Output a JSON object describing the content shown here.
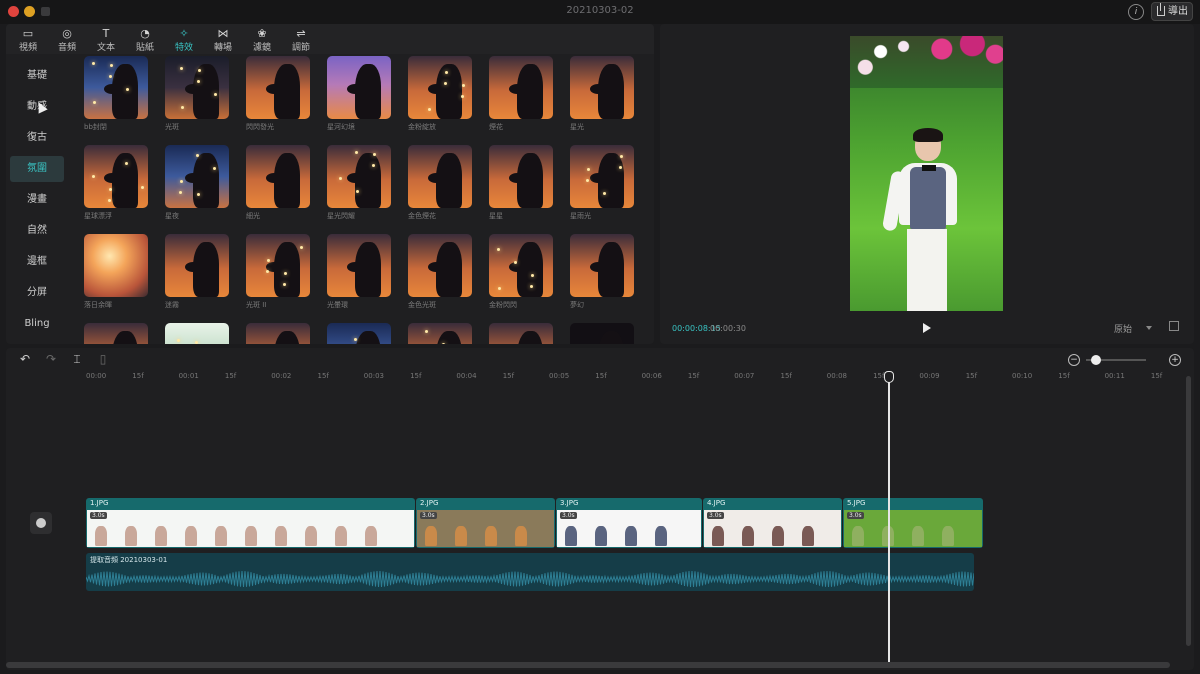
{
  "window": {
    "title": "20210303-02",
    "export_label": "導出"
  },
  "tabs": [
    {
      "label": "視頻",
      "icon": "video-icon",
      "glyph": "▭"
    },
    {
      "label": "音頻",
      "icon": "audio-icon",
      "glyph": "◎"
    },
    {
      "label": "文本",
      "icon": "text-icon",
      "glyph": "T"
    },
    {
      "label": "貼紙",
      "icon": "sticker-icon",
      "glyph": "◔"
    },
    {
      "label": "特效",
      "icon": "effects-icon",
      "glyph": "✧"
    },
    {
      "label": "轉場",
      "icon": "transition-icon",
      "glyph": "⋈"
    },
    {
      "label": "濾鏡",
      "icon": "filter-icon",
      "glyph": "❀"
    },
    {
      "label": "調節",
      "icon": "adjust-icon",
      "glyph": "⇌"
    }
  ],
  "active_tab": 4,
  "categories": [
    "基礎",
    "動感",
    "復古",
    "氛圍",
    "漫畫",
    "自然",
    "邊框",
    "分屏",
    "Bling"
  ],
  "active_category": 3,
  "effects": [
    {
      "name": "bb封閉",
      "style": "blue"
    },
    {
      "name": "光斑",
      "style": "dark"
    },
    {
      "name": "閃閃發光",
      "style": "normal"
    },
    {
      "name": "星河幻境",
      "style": "violet"
    },
    {
      "name": "金粉綻放",
      "style": "normal"
    },
    {
      "name": "煙花",
      "style": "normal"
    },
    {
      "name": "星光",
      "style": "normal"
    },
    {
      "name": "星球漂浮",
      "style": "normal"
    },
    {
      "name": "星夜",
      "style": "blue"
    },
    {
      "name": "細光",
      "style": "normal"
    },
    {
      "name": "星光閃耀",
      "style": "normal"
    },
    {
      "name": "金色煙花",
      "style": "normal"
    },
    {
      "name": "星星",
      "style": "normal"
    },
    {
      "name": "星雨光",
      "style": "normal"
    },
    {
      "name": "落日余暉",
      "style": "bright"
    },
    {
      "name": "迷霧",
      "style": "normal"
    },
    {
      "name": "光斑 II",
      "style": "normal"
    },
    {
      "name": "光暈環",
      "style": "normal"
    },
    {
      "name": "金色光斑",
      "style": "normal"
    },
    {
      "name": "金粉閃閃",
      "style": "normal"
    },
    {
      "name": "夢幻",
      "style": "normal"
    },
    {
      "name": "",
      "style": "normal"
    },
    {
      "name": "",
      "style": "green"
    },
    {
      "name": "",
      "style": "normal"
    },
    {
      "name": "",
      "style": "blue"
    },
    {
      "name": "",
      "style": "normal"
    },
    {
      "name": "",
      "style": "normal"
    },
    {
      "name": "",
      "style": "black"
    }
  ],
  "preview": {
    "timecode_current": "00:00:08:15",
    "timecode_total": "00:00:30",
    "ratio_label": "原始"
  },
  "ruler": [
    "00:00",
    "15f",
    "00:01",
    "15f",
    "00:02",
    "15f",
    "00:03",
    "15f",
    "00:04",
    "15f",
    "00:05",
    "15f",
    "00:06",
    "15f",
    "00:07",
    "15f",
    "00:08",
    "15f",
    "00:09",
    "15f",
    "00:10",
    "15f",
    "00:11",
    "15f"
  ],
  "clips": [
    {
      "name": "1.JPG",
      "duration": "3.0s"
    },
    {
      "name": "2.JPG",
      "duration": "3.0s"
    },
    {
      "name": "3.JPG",
      "duration": "3.0s"
    },
    {
      "name": "4.JPG",
      "duration": "3.0s"
    },
    {
      "name": "5.JPG",
      "duration": "3.0s"
    }
  ],
  "audio": {
    "name": "提取音頻 20210303-01"
  },
  "colors": {
    "accent": "#39c3c3",
    "clip": "#166a6c",
    "audio": "#153d48"
  }
}
